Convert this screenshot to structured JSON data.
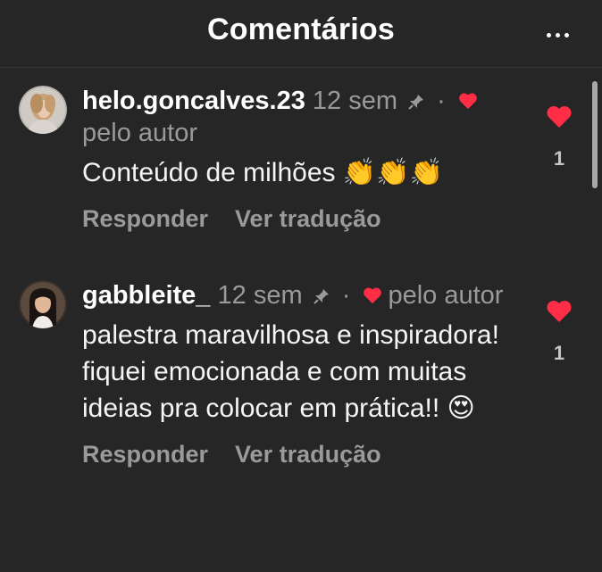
{
  "header": {
    "title": "Comentários"
  },
  "colors": {
    "background": "#262626",
    "like_red": "#ff2d45",
    "muted_text": "#9a9a9a"
  },
  "comments": [
    {
      "username": "helo.goncalves.23",
      "time": "12 sem",
      "dot": "·",
      "liked_by": "pelo autor",
      "text": "Conteúdo de milhões 👏👏👏",
      "reply_label": "Responder",
      "translate_label": "Ver tradução",
      "like_count": "1"
    },
    {
      "username": "gabbleite_",
      "time": "12 sem",
      "dot": "·",
      "liked_by": "pelo autor",
      "text": "palestra maravilhosa e inspiradora! fiquei emocionada e com muitas ideias pra colocar em prática!! 😍",
      "reply_label": "Responder",
      "translate_label": "Ver tradução",
      "like_count": "1"
    }
  ]
}
